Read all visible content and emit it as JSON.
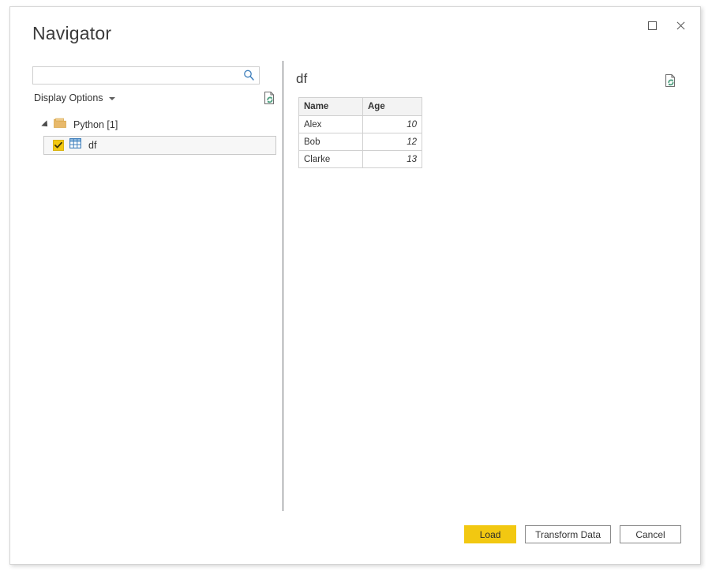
{
  "window": {
    "title": "Navigator",
    "maximize_label": "Maximize",
    "close_label": "Close"
  },
  "left_pane": {
    "search": {
      "value": "",
      "placeholder": ""
    },
    "display_options": {
      "label": "Display Options",
      "caret": "chevron-down-icon"
    },
    "refresh_label": "Refresh",
    "tree": {
      "folder": {
        "label": "Python [1]",
        "expanded": true
      },
      "items": [
        {
          "label": "df",
          "checked": true,
          "selected": true
        }
      ]
    }
  },
  "right_pane": {
    "preview_title": "df",
    "refresh_label": "Refresh",
    "table": {
      "columns": [
        "Name",
        "Age"
      ],
      "rows": [
        {
          "name": "Alex",
          "age": "10"
        },
        {
          "name": "Bob",
          "age": "12"
        },
        {
          "name": "Clarke",
          "age": "13"
        }
      ]
    }
  },
  "footer": {
    "load_label": "Load",
    "transform_label": "Transform Data",
    "cancel_label": "Cancel"
  },
  "colors": {
    "accent_yellow": "#F2C811",
    "folder_tan": "#E8B96B",
    "table_icon_blue": "#3D7EBB",
    "refresh_green": "#4E9E7E",
    "divider_gray": "#6B6E72",
    "border_gray": "#D0D0D0"
  }
}
